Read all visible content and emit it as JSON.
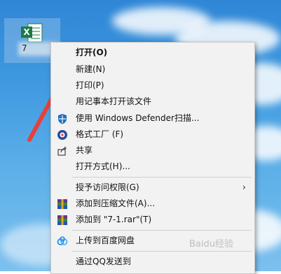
{
  "desktop": {
    "file_label": "7"
  },
  "menu": {
    "items": [
      {
        "label": "打开(O)",
        "bold": true
      },
      {
        "label": "新建(N)"
      },
      {
        "label": "打印(P)"
      },
      {
        "label": "用记事本打开该文件"
      },
      {
        "label": "使用 Windows Defender扫描...",
        "icon": "windows-defender-shield-icon"
      },
      {
        "label": "格式工厂 (F)",
        "icon": "format-factory-icon"
      },
      {
        "label": "共享",
        "icon": "share-icon"
      },
      {
        "label": "打开方式(H)..."
      },
      {
        "label": "授予访问权限(G)",
        "submenu": true
      },
      {
        "label": "添加到压缩文件(A)...",
        "icon": "winrar-icon"
      },
      {
        "label": "添加到 \"7-1.rar\"(T)",
        "icon": "winrar-icon"
      },
      {
        "label": "上传到百度网盘",
        "icon": "baidu-netdisk-icon"
      },
      {
        "label": "通过QQ发送到"
      }
    ],
    "submenu_glyph": "›"
  },
  "watermark": "Baidu经验",
  "colors": {
    "arrow": "#e8403a",
    "menu_bg": "#f2f2f2",
    "excel_green": "#1d7a43"
  }
}
